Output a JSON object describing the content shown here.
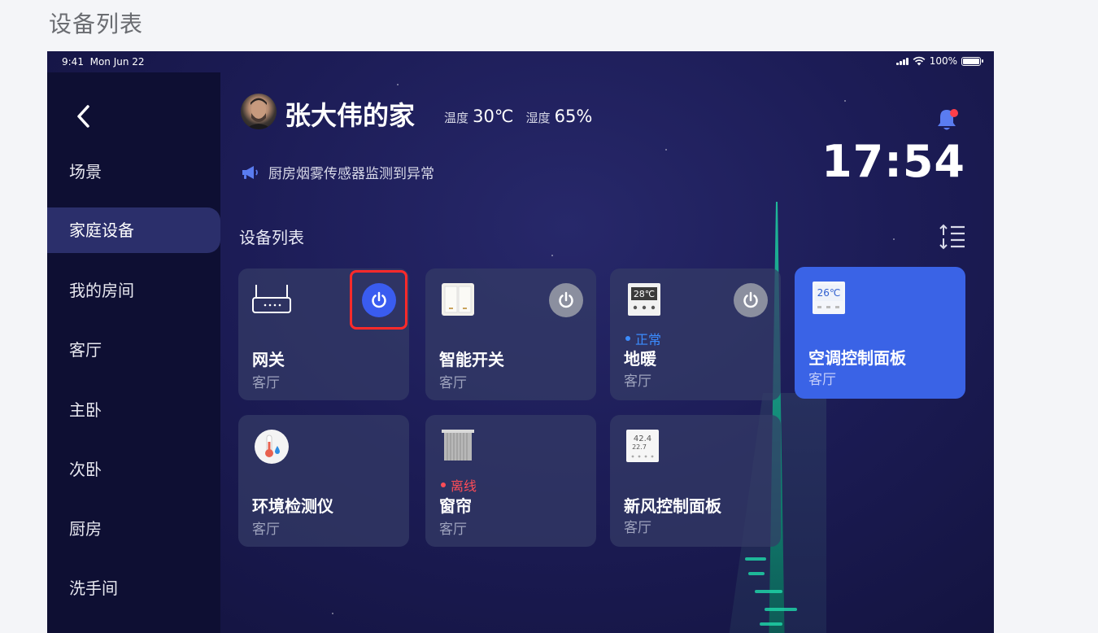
{
  "page_heading": "设备列表",
  "status_bar": {
    "time": "9:41",
    "date": "Mon Jun 22",
    "battery": "100%"
  },
  "sidebar": {
    "items": [
      {
        "label": "场景",
        "active": false
      },
      {
        "label": "家庭设备",
        "active": true
      },
      {
        "label": "我的房间",
        "active": false
      },
      {
        "label": "客厅",
        "active": false
      },
      {
        "label": "主卧",
        "active": false
      },
      {
        "label": "次卧",
        "active": false
      },
      {
        "label": "厨房",
        "active": false
      },
      {
        "label": "洗手间",
        "active": false
      }
    ]
  },
  "header": {
    "home_name": "张大伟的家",
    "temp_label": "温度",
    "temp_value": "30℃",
    "humidity_label": "湿度",
    "humidity_value": "65%",
    "notice": "厨房烟雾传感器监测到异常",
    "time": "17:54"
  },
  "section_title": "设备列表",
  "devices": [
    {
      "name": "网关",
      "room": "客厅",
      "icon": "router-icon",
      "power": "on"
    },
    {
      "name": "智能开关",
      "room": "客厅",
      "icon": "switch-icon",
      "power": "off"
    },
    {
      "name": "地暖",
      "room": "客厅",
      "icon": "thermostat-icon",
      "power": "off",
      "status": "正常",
      "status_color": "#3b8cff",
      "display_temp": "28℃"
    },
    {
      "name": "空调控制面板",
      "room": "客厅",
      "icon": "ac-panel-icon",
      "active": true,
      "display_temp": "26℃"
    },
    {
      "name": "环境检测仪",
      "room": "客厅",
      "icon": "thermometer-icon"
    },
    {
      "name": "窗帘",
      "room": "客厅",
      "icon": "curtain-icon",
      "status": "离线",
      "status_color": "#ff4d57"
    },
    {
      "name": "新风控制面板",
      "room": "客厅",
      "icon": "air-panel-icon",
      "display_line1": "42.4",
      "display_line2": "22.7"
    }
  ],
  "colors": {
    "accent": "#3a63e6",
    "power_on": "#3a5cf0",
    "highlight": "#ff2a2a"
  }
}
